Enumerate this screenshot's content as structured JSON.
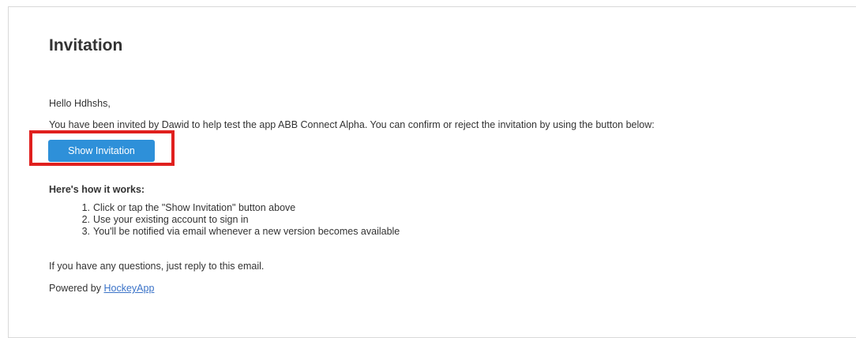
{
  "email": {
    "title": "Invitation",
    "greeting": "Hello Hdhshs,",
    "intro": "You have been invited by Dawid to help test the app ABB Connect Alpha. You can confirm or reject the invitation by using the button below:",
    "button_label": "Show Invitation",
    "how_heading": "Here's how it works:",
    "steps": [
      {
        "num": "1.",
        "text": "Click or tap the \"Show Invitation\" button above"
      },
      {
        "num": "2.",
        "text": "Use your existing account to sign in"
      },
      {
        "num": "3.",
        "text": "You'll be notified via email whenever a new version becomes available"
      }
    ],
    "questions": "If you have any questions, just reply to this email.",
    "powered_prefix": "Powered by ",
    "powered_link": "HockeyApp"
  },
  "colors": {
    "button_bg": "#2e90d9",
    "highlight_border": "#e0201e",
    "link": "#3b73c8"
  }
}
